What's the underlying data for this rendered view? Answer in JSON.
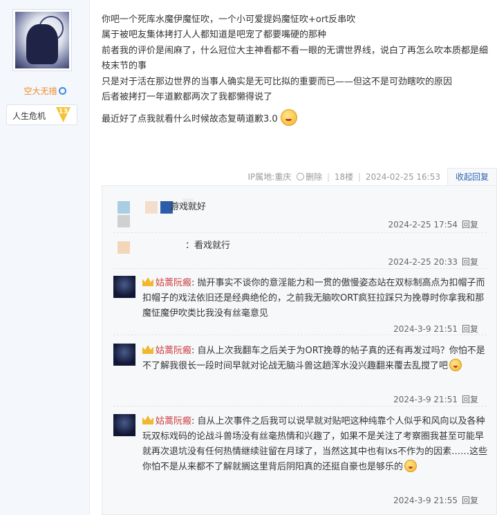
{
  "author": {
    "username": "空大无措",
    "level_name": "人生危机",
    "level_number": "13"
  },
  "post": {
    "lines": [
      "你吧一个死库水魔伊魔怔吹，一个小可爱提妈魔怔吹+ort反串吹",
      "属于被吧友集体拷打人人都知道是吧宠了都要嘴硬的那种",
      "前者我的评价是闹麻了，什么冠位大主神看都不看一眼的无谓世界线，说白了再怎么吹本质都是细枝末节的事",
      "只是对于活在那边世界的当事人确实是无可比拟的重要而已——但这不是可劲瞎吹的原因",
      "后者被拷打一年道歉都两次了我都懒得说了",
      "最近好了点我就看什么时候故态复萌道歉3.0"
    ],
    "meta": {
      "ip_location": "IP属地:重庆",
      "delete_label": "删除",
      "floor": "18楼",
      "time": "2024-02-25 16:53"
    },
    "collapse_reply_label": "收起回复"
  },
  "replies": [
    {
      "text": "游戏就好",
      "time": "2024-2-25 17:54",
      "reply_label": "回复"
    },
    {
      "text": "：看戏就行",
      "time": "2024-2-25 20:33",
      "reply_label": "回复"
    },
    {
      "username": "姑蒿阮瘢",
      "text": ": 抛开事实不谈你的意淫能力和一贯的傲慢姿态站在双标制高点为扣帽子而扣帽子的戏法依旧还是经典绝伦的，之前我无脑吹ORT疯狂拉踩只为挽尊时你拿我和那魔怔魔伊吹类比我没有丝毫意见",
      "time": "2024-3-9 21:51",
      "reply_label": "回复"
    },
    {
      "username": "姑蒿阮瘢",
      "text": ": 自从上次我翻车之后关于为ORT挽尊的帖子真的还有再发过吗？你怕不是不了解我很长一段时间早就对论战无脑斗兽这趟浑水没兴趣翻来覆去乱搅了吧",
      "time": "2024-3-9 21:51",
      "reply_label": "回复"
    },
    {
      "username": "姑蒿阮瘢",
      "text": ": 自从上次事件之后我可以说早就对贴吧这种纯靠个人似乎和风向以及各种玩双标戏码的论战斗兽场没有丝毫热情和兴趣了，如果不是关注了考察圈我甚至可能早就再次退坑没有任何热情继续驻留在月球了，当然这其中也有lxs不作为的因素……这些你怕不是从来都不了解就搁这里背后阴阳真的还挺自豪也是够乐的",
      "time": "2024-3-9 21:55",
      "reply_label": "回复"
    }
  ],
  "colors": {
    "accent_link": "#2d64b3",
    "username_orange": "#f08c2c",
    "reply_username_red": "#cc3b3b",
    "badge_gold": "#f5c235"
  }
}
